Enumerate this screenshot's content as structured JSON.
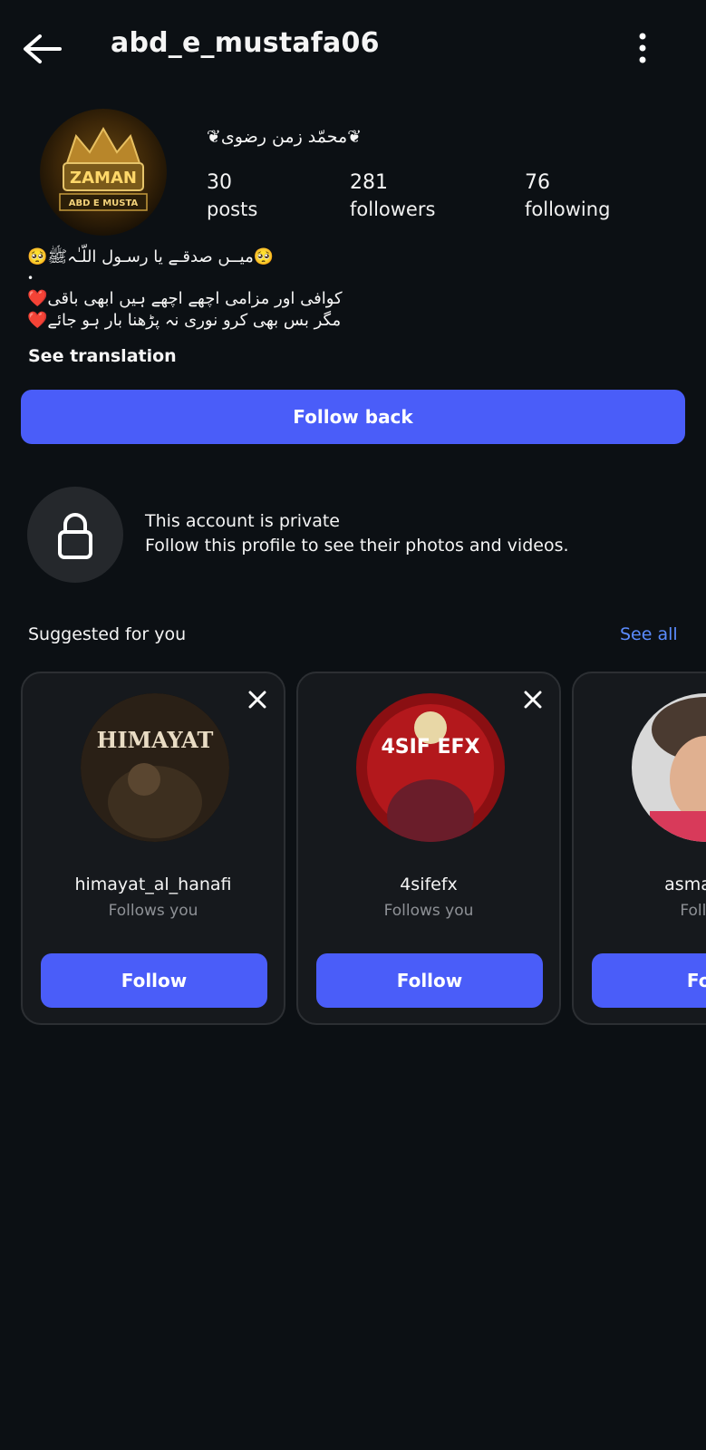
{
  "header": {
    "username": "abd_e_mustafa06"
  },
  "profile": {
    "full_name": "❦محمّد زمن رضوی❦",
    "avatar_text_top": "ZAMAN",
    "avatar_text_bottom": "ABD E MUSTA",
    "stats": [
      {
        "value": "30",
        "label": "posts"
      },
      {
        "value": "281",
        "label": "followers"
      },
      {
        "value": "76",
        "label": "following"
      }
    ],
    "bio_lines": [
      "🥺میــں صدقـے یا رسـول اللّـٰہﷺ🥺",
      "•",
      "❤️کوافی اور مزامی اچھے اچھے ہیں ابھی باقی",
      "❤️مگر بس بھی کرو نوری نہ پڑھنا بار ہو جائے"
    ],
    "see_translation": "See translation",
    "follow_back_label": "Follow back"
  },
  "private_notice": {
    "title": "This account is private",
    "description": "Follow this profile to see their photos and videos."
  },
  "suggested": {
    "title": "Suggested for you",
    "see_all": "See all",
    "cards": [
      {
        "username": "himayat_al_hanafi",
        "subtitle": "Follows you",
        "button": "Follow",
        "avatar_text": "HIMAYAT"
      },
      {
        "username": "4sifefx",
        "subtitle": "Follows you",
        "button": "Follow",
        "avatar_text": "4SIF EFX"
      },
      {
        "username": "asmalray",
        "subtitle": "Follow",
        "button": "Foll"
      }
    ]
  },
  "colors": {
    "background": "#0c1014",
    "accent": "#4a5df9",
    "link": "#5b8cff",
    "card_bg": "#16191d"
  }
}
